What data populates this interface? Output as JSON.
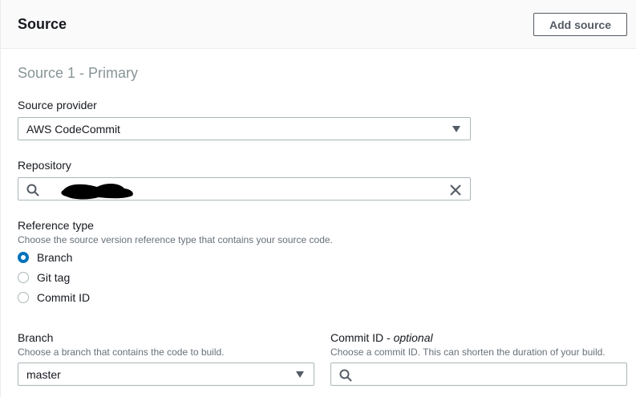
{
  "header": {
    "title": "Source",
    "add_source_label": "Add source"
  },
  "source": {
    "section_title": "Source 1 - Primary",
    "provider": {
      "label": "Source provider",
      "value": "AWS CodeCommit"
    },
    "repository": {
      "label": "Repository",
      "value": ""
    },
    "reference_type": {
      "label": "Reference type",
      "description": "Choose the source version reference type that contains your source code.",
      "options": [
        {
          "label": "Branch",
          "checked": true
        },
        {
          "label": "Git tag",
          "checked": false
        },
        {
          "label": "Commit ID",
          "checked": false
        }
      ]
    },
    "branch": {
      "label": "Branch",
      "description": "Choose a branch that contains the code to build.",
      "value": "master"
    },
    "commit_id": {
      "label": "Commit ID",
      "optional_label": "optional",
      "separator": " - ",
      "description": "Choose a commit ID. This can shorten the duration of your build.",
      "value": ""
    }
  },
  "colors": {
    "accent": "#0073bb",
    "border": "#aab7b8",
    "muted": "#687078"
  }
}
